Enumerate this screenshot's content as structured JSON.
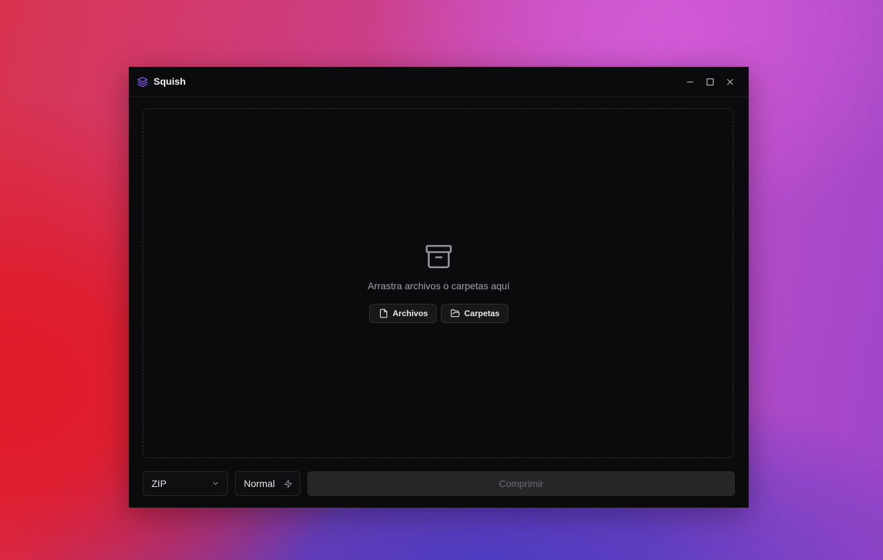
{
  "app": {
    "title": "Squish",
    "icon": "layers-icon",
    "accent_color": "#8b5cf6"
  },
  "window_controls": {
    "minimize_icon": "minimize-icon",
    "maximize_icon": "maximize-icon",
    "close_icon": "close-icon"
  },
  "dropzone": {
    "icon": "archive-icon",
    "text": "Arrastra archivos o carpetas aquí",
    "files_button": {
      "label": "Archivos",
      "icon": "file-icon"
    },
    "folders_button": {
      "label": "Carpetas",
      "icon": "folder-open-icon"
    }
  },
  "footer": {
    "format_select": {
      "value": "ZIP",
      "icon": "chevron-down-icon"
    },
    "level_select": {
      "value": "Normal",
      "icon": "zap-icon"
    },
    "compress_button": {
      "label": "Comprimir",
      "enabled": false
    }
  }
}
